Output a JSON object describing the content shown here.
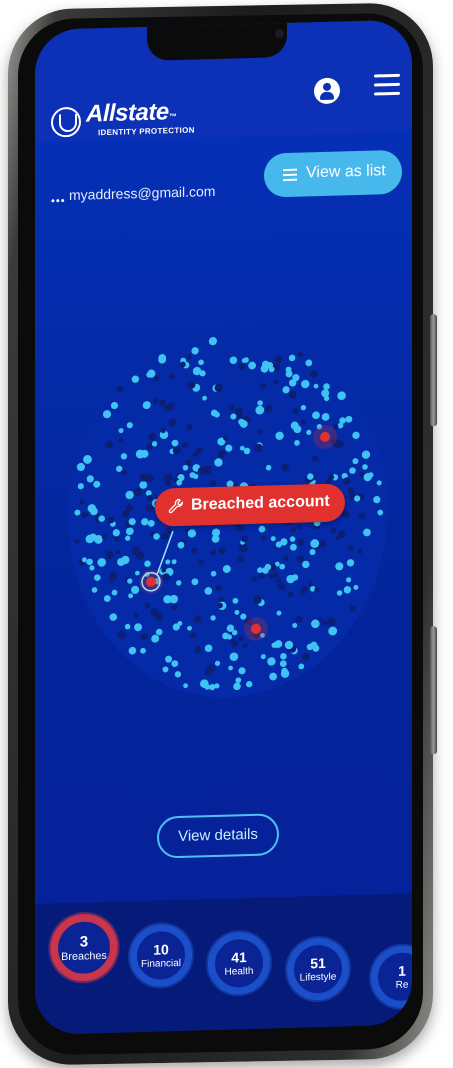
{
  "brand": {
    "name": "Allstate",
    "trademark": "™",
    "subtitle": "IDENTITY PROTECTION"
  },
  "header": {
    "user_icon": "user-icon",
    "menu_icon": "menu-icon"
  },
  "account": {
    "dots": "•••",
    "email": "myaddress@gmail.com"
  },
  "actions": {
    "view_list_label": "View as list",
    "view_details_label": "View details"
  },
  "breach_tag": {
    "label": "Breached account",
    "icon": "wrench-icon"
  },
  "categories": [
    {
      "count": "3",
      "label": "Breaches"
    },
    {
      "count": "10",
      "label": "Financial"
    },
    {
      "count": "41",
      "label": "Health"
    },
    {
      "count": "51",
      "label": "Lifestyle"
    },
    {
      "count": "1",
      "label": "Re"
    }
  ],
  "colors": {
    "accent": "#46b8ec",
    "background": "#0530b5",
    "alert": "#e0312f"
  }
}
